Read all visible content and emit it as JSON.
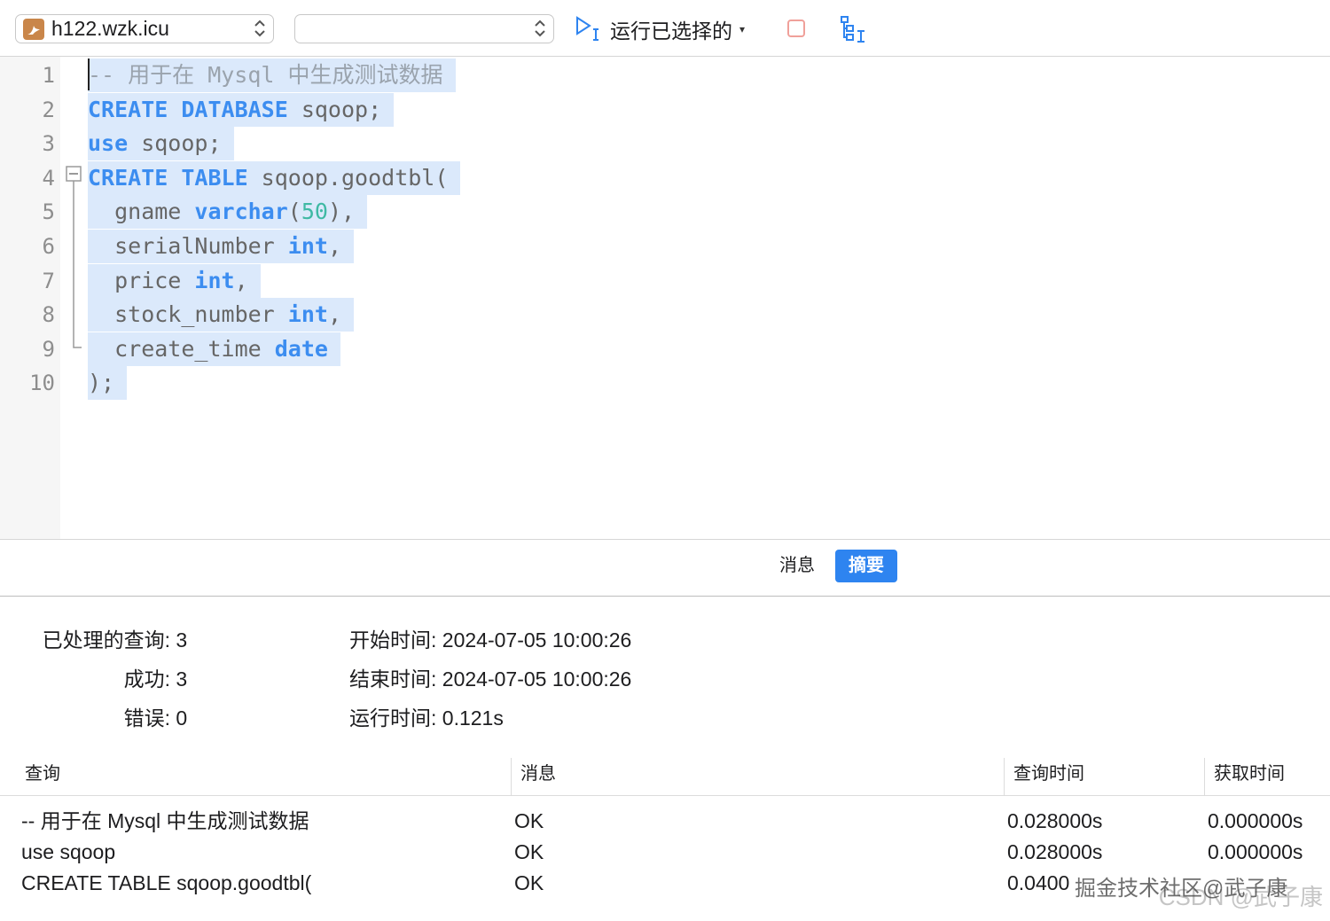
{
  "toolbar": {
    "connection": "h122.wzk.icu",
    "database": "",
    "run_selected_label": "运行已选择的",
    "run_dropdown_caret": "▾"
  },
  "editor": {
    "line_numbers": [
      "1",
      "2",
      "3",
      "4",
      "5",
      "6",
      "7",
      "8",
      "9",
      "10"
    ],
    "lines": [
      [
        {
          "t": "-- 用于在 Mysql 中生成测试数据",
          "c": "cm"
        }
      ],
      [
        {
          "t": "CREATE DATABASE",
          "c": "kw"
        },
        {
          "t": " sqoop;",
          "c": ""
        }
      ],
      [
        {
          "t": "use",
          "c": "kw"
        },
        {
          "t": " sqoop;",
          "c": ""
        }
      ],
      [
        {
          "t": "CREATE TABLE",
          "c": "kw"
        },
        {
          "t": " sqoop.goodtbl(",
          "c": ""
        }
      ],
      [
        {
          "t": "  gname ",
          "c": ""
        },
        {
          "t": "varchar",
          "c": "kw"
        },
        {
          "t": "(",
          "c": ""
        },
        {
          "t": "50",
          "c": "nm"
        },
        {
          "t": "),",
          "c": ""
        }
      ],
      [
        {
          "t": "  serialNumber ",
          "c": ""
        },
        {
          "t": "int",
          "c": "kw"
        },
        {
          "t": ",",
          "c": ""
        }
      ],
      [
        {
          "t": "  price ",
          "c": ""
        },
        {
          "t": "int",
          "c": "kw"
        },
        {
          "t": ",",
          "c": ""
        }
      ],
      [
        {
          "t": "  stock_number ",
          "c": ""
        },
        {
          "t": "int",
          "c": "kw"
        },
        {
          "t": ",",
          "c": ""
        }
      ],
      [
        {
          "t": "  create_time ",
          "c": ""
        },
        {
          "t": "date",
          "c": "kw"
        }
      ],
      [
        {
          "t": ");",
          "c": ""
        }
      ]
    ]
  },
  "tabs": {
    "messages": "消息",
    "summary": "摘要"
  },
  "summary": {
    "processed_label": "已处理的查询:",
    "processed_value": "3",
    "success_label": "成功:",
    "success_value": "3",
    "error_label": "错误:",
    "error_value": "0",
    "start_label": "开始时间:",
    "start_value": "2024-07-05 10:00:26",
    "end_label": "结束时间:",
    "end_value": "2024-07-05 10:00:26",
    "elapsed_label": "运行时间:",
    "elapsed_value": "0.121s"
  },
  "results": {
    "headers": [
      "查询",
      "消息",
      "查询时间",
      "获取时间"
    ],
    "rows": [
      [
        "-- 用于在 Mysql 中生成测试数据",
        "OK",
        "0.028000s",
        "0.000000s"
      ],
      [
        "use sqoop",
        "OK",
        "0.028000s",
        "0.000000s"
      ],
      [
        "CREATE TABLE sqoop.goodtbl(",
        "OK",
        "0.0400",
        ""
      ]
    ]
  },
  "watermark": {
    "juejin": "掘金技术社区@武子康",
    "csdn": "CSDN @武子康"
  },
  "colors": {
    "keyword": "#3c8df0",
    "selection": "#dbe9fb",
    "accent": "#2e84f0"
  }
}
